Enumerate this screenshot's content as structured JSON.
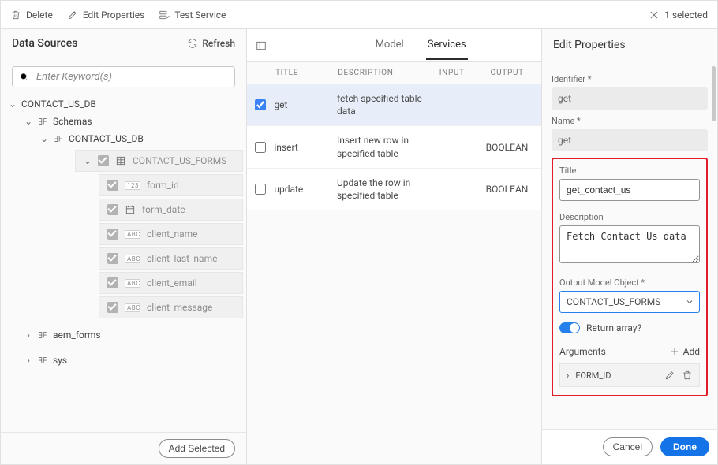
{
  "topbar": {
    "delete": "Delete",
    "edit_properties": "Edit Properties",
    "test_service": "Test Service",
    "selected_count": "1 selected"
  },
  "sidebar": {
    "title": "Data Sources",
    "refresh": "Refresh",
    "search_placeholder": "Enter Keyword(s)",
    "add_selected": "Add Selected",
    "db": "CONTACT_US_DB",
    "schemas": "Schemas",
    "schema_db": "CONTACT_US_DB",
    "table": "CONTACT_US_FORMS",
    "cols": [
      {
        "type": "123",
        "name": "form_id"
      },
      {
        "type": "date",
        "name": "form_date"
      },
      {
        "type": "ABC",
        "name": "client_name"
      },
      {
        "type": "ABC",
        "name": "client_last_name"
      },
      {
        "type": "ABC",
        "name": "client_email"
      },
      {
        "type": "ABC",
        "name": "client_message"
      }
    ],
    "extra": [
      "aem_forms",
      "sys"
    ]
  },
  "center": {
    "tabs": {
      "model": "Model",
      "services": "Services"
    },
    "headers": {
      "title": "TITLE",
      "description": "DESCRIPTION",
      "input": "INPUT",
      "output": "OUTPUT"
    },
    "rows": [
      {
        "title": "get",
        "description": "fetch specified table data",
        "input": "",
        "output": "",
        "checked": true
      },
      {
        "title": "insert",
        "description": "Insert new row in specified table",
        "input": "",
        "output": "BOOLEAN",
        "checked": false
      },
      {
        "title": "update",
        "description": "Update the row in specified table",
        "input": "",
        "output": "BOOLEAN",
        "checked": false
      }
    ]
  },
  "right": {
    "header": "Edit Properties",
    "identifier_label": "Identifier *",
    "identifier_value": "get",
    "name_label": "Name *",
    "name_value": "get",
    "title_label": "Title",
    "title_value": "get_contact_us",
    "description_label": "Description",
    "description_value": "Fetch Contact Us data",
    "output_model_label": "Output Model Object *",
    "output_model_value": "CONTACT_US_FORMS",
    "return_array_label": "Return array?",
    "arguments_label": "Arguments",
    "add_label": "Add",
    "arg0": "FORM_ID",
    "cancel": "Cancel",
    "done": "Done"
  }
}
